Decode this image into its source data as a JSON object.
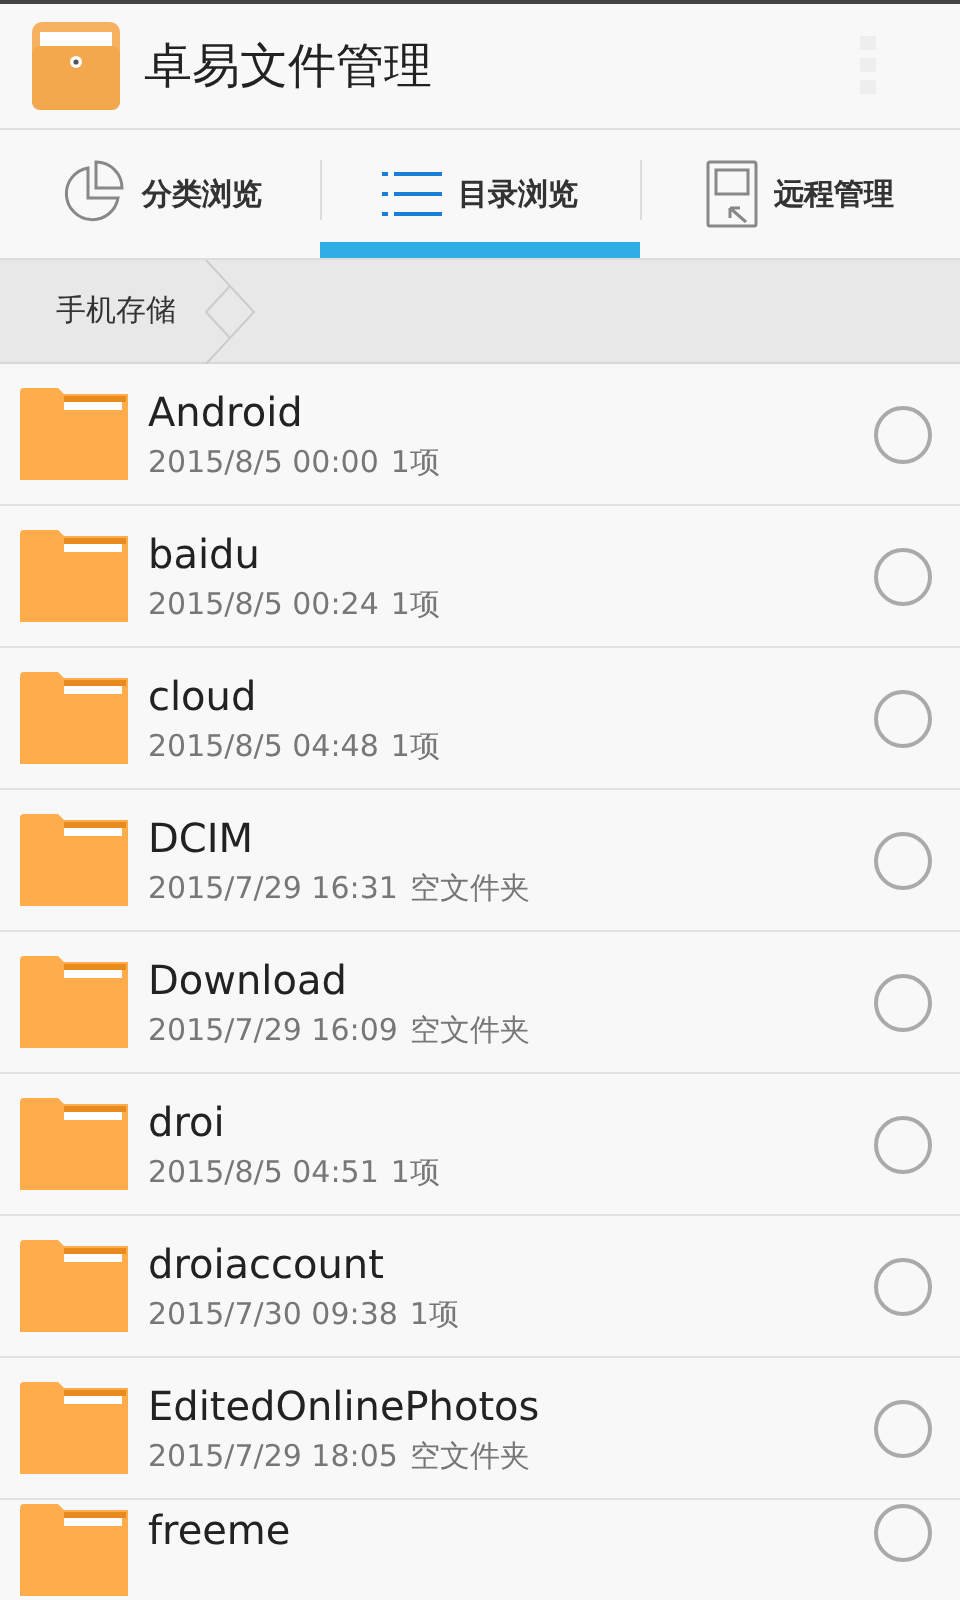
{
  "app_bar": {
    "title": "卓易文件管理"
  },
  "tabs": [
    {
      "label": "分类浏览",
      "kind": "pie",
      "selected": false
    },
    {
      "label": "目录浏览",
      "kind": "list",
      "selected": true
    },
    {
      "label": "远程管理",
      "kind": "remote",
      "selected": false
    }
  ],
  "breadcrumb": [
    "手机存储"
  ],
  "files": [
    {
      "name": "Android",
      "date": "2015/8/5 00:00",
      "info": "1项",
      "selected": false
    },
    {
      "name": "baidu",
      "date": "2015/8/5 00:24",
      "info": "1项",
      "selected": false
    },
    {
      "name": "cloud",
      "date": "2015/8/5 04:48",
      "info": "1项",
      "selected": false
    },
    {
      "name": "DCIM",
      "date": "2015/7/29 16:31",
      "info": "空文件夹",
      "selected": false
    },
    {
      "name": "Download",
      "date": "2015/7/29 16:09",
      "info": "空文件夹",
      "selected": false
    },
    {
      "name": "droi",
      "date": "2015/8/5 04:51",
      "info": "1项",
      "selected": false
    },
    {
      "name": "droiaccount",
      "date": "2015/7/30 09:38",
      "info": "1项",
      "selected": false
    },
    {
      "name": "EditedOnlinePhotos",
      "date": "2015/7/29 18:05",
      "info": "空文件夹",
      "selected": false
    },
    {
      "name": "freeme",
      "selected": false
    }
  ]
}
